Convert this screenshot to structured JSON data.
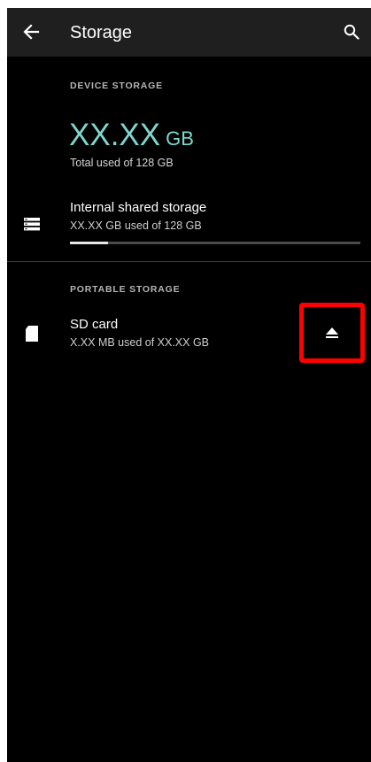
{
  "app_bar": {
    "title": "Storage",
    "back_icon": "arrow-left-icon",
    "search_icon": "search-icon"
  },
  "device_storage": {
    "section_label": "DEVICE STORAGE",
    "used_value": "XX.XX",
    "used_unit": "GB",
    "total_text": "Total used of 128 GB",
    "accent_color": "#7fd7cf"
  },
  "internal_storage": {
    "icon": "storage-stack-icon",
    "title": "Internal shared storage",
    "subtitle": "XX.XX GB used of 128 GB",
    "progress_fraction": 0.13
  },
  "portable_storage": {
    "section_label": "PORTABLE STORAGE",
    "sd_card": {
      "icon": "sd-card-icon",
      "title": "SD card",
      "subtitle": "X.XX MB used of XX.XX GB",
      "eject_icon": "eject-icon",
      "highlight_color": "#ff0000"
    }
  }
}
